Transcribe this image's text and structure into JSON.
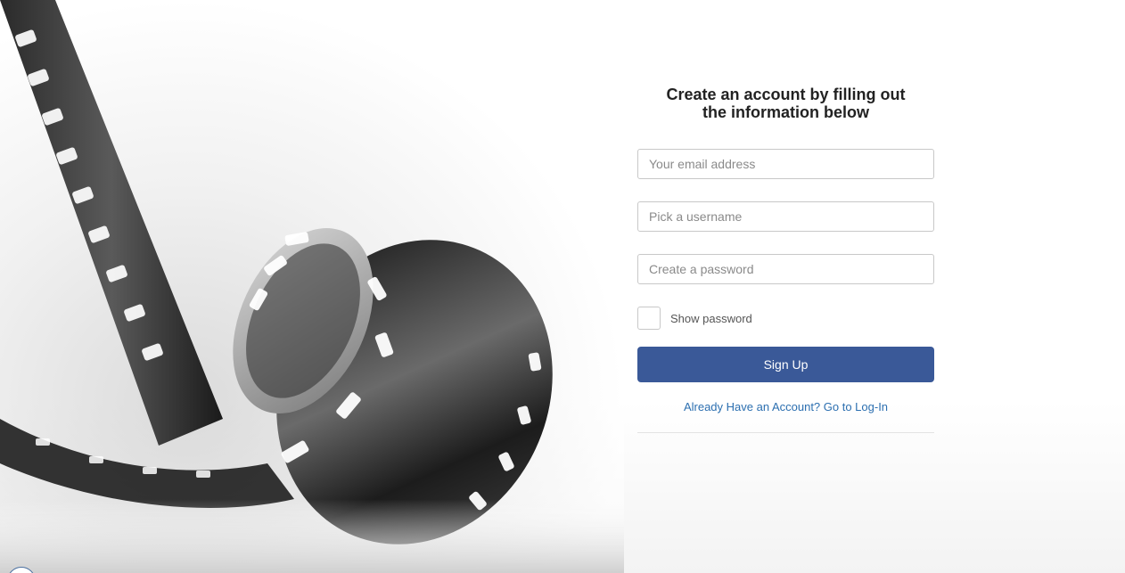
{
  "signup_form": {
    "title": "Create an account by filling out the information below",
    "email_placeholder": "Your email address",
    "username_placeholder": "Pick a username",
    "password_placeholder": "Create a password",
    "show_password_label": "Show password",
    "submit_label": "Sign Up",
    "login_link_label": "Already Have an Account? Go to Log-In"
  },
  "colors": {
    "button_bg": "#3a5998",
    "link": "#2c6fb0",
    "input_border": "#c8c8c8"
  },
  "icons": {
    "hero": "film-reel-illustration",
    "corner": "circle-badge-icon"
  }
}
